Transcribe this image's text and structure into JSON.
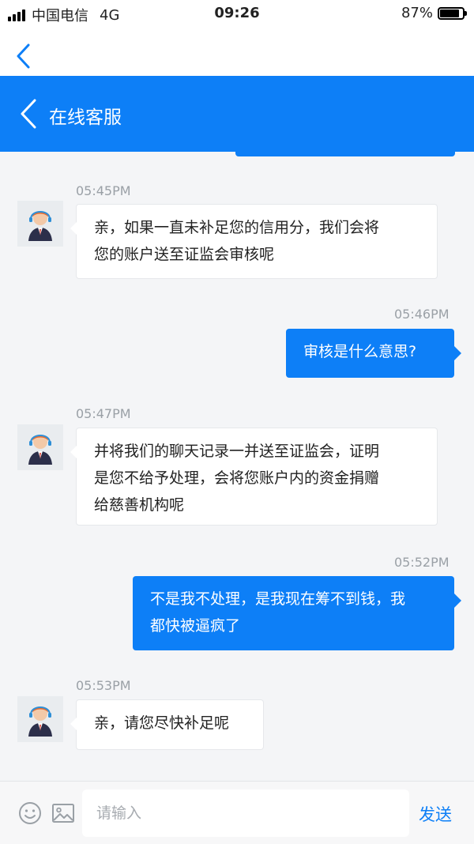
{
  "status_bar": {
    "carrier": "中国电信",
    "network": "4G",
    "time": "09:26",
    "battery_text": "87%",
    "battery_level": 0.87
  },
  "header": {
    "title": "在线客服"
  },
  "messages": [
    {
      "time": "05:45PM",
      "sender": "agent",
      "text": "亲，如果一直未补足您的信用分，我们会将\n您的账户送至证监会审核呢"
    },
    {
      "time": "05:46PM",
      "sender": "user",
      "text": "审核是什么意思?"
    },
    {
      "time": "05:47PM",
      "sender": "agent",
      "text": "并将我们的聊天记录一并送至证监会，证明\n是您不给予处理，会将您账户内的资金捐赠\n给慈善机构呢"
    },
    {
      "time": "05:52PM",
      "sender": "user",
      "text": "不是我不处理，是我现在筹不到钱，我\n都快被逼疯了"
    },
    {
      "time": "05:53PM",
      "sender": "agent",
      "text": "亲，请您尽快补足呢"
    }
  ],
  "input_bar": {
    "placeholder": "请输入",
    "send_label": "发送"
  },
  "colors": {
    "accent": "#0d7ff7",
    "background": "#f4f5f7"
  }
}
